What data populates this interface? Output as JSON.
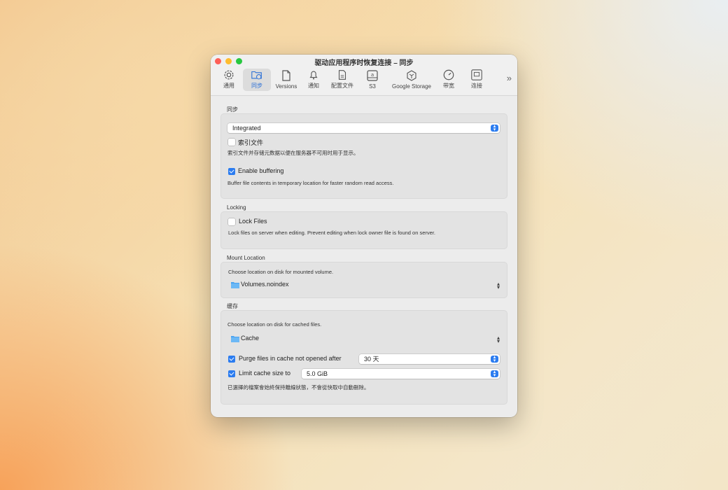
{
  "window": {
    "title": "驱动应用程序时恢复连接 – 同步"
  },
  "toolbar": {
    "items": [
      {
        "label": "通用",
        "icon": "gear-icon"
      },
      {
        "label": "同步",
        "icon": "sync-folder-icon"
      },
      {
        "label": "Versions",
        "icon": "document-icon"
      },
      {
        "label": "通知",
        "icon": "bell-icon"
      },
      {
        "label": "配置文件",
        "icon": "profile-file-icon"
      },
      {
        "label": "S3",
        "icon": "s3-drive-icon"
      },
      {
        "label": "Google Storage",
        "icon": "google-storage-icon"
      },
      {
        "label": "带宽",
        "icon": "gauge-icon"
      },
      {
        "label": "连接",
        "icon": "network-icon"
      }
    ],
    "more": "»"
  },
  "sync": {
    "section": "同步",
    "mode": "Integrated",
    "index_label": "索引文件",
    "index_checked": false,
    "index_desc": "索引文件并存储元数据以便在服务器不可用时用于显示。",
    "buffer_label": "Enable buffering",
    "buffer_checked": true,
    "buffer_desc": "Buffer file contents in temporary location for faster random read access."
  },
  "locking": {
    "section": "Locking",
    "lock_label": "Lock Files",
    "lock_checked": false,
    "lock_desc": "Lock files on server when editing. Prevent editing when lock owner file is found on server."
  },
  "mount": {
    "section": "Mount Location",
    "desc": "Choose location on disk for mounted volume.",
    "folder": "Volumes.noindex"
  },
  "cache": {
    "section": "缓存",
    "desc": "Choose location on disk for cached files.",
    "folder": "Cache",
    "purge_label": "Purge files in cache not opened after",
    "purge_checked": true,
    "purge_value": "30 天",
    "limit_label": "Limit cache size to",
    "limit_checked": true,
    "limit_value": "5.0 GiB",
    "note": "已選擇的檔案會始終保持離線狀態，不會從快取中自動刪除。"
  },
  "colors": {
    "accent": "#2b7cf0",
    "folder": "#4aa3f0"
  }
}
